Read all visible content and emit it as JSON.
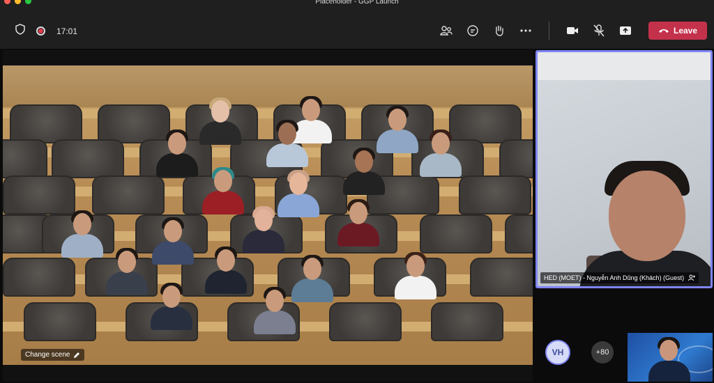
{
  "window": {
    "title": "Placeholder - GGP Launch"
  },
  "toolbar": {
    "timer": "17:01",
    "leave_label": "Leave",
    "icons": [
      "shield-icon",
      "recording-icon",
      "people-icon",
      "chat-icon",
      "raise-hand-icon",
      "more-icon",
      "camera-icon",
      "mic-off-icon",
      "share-icon",
      "phone-icon"
    ]
  },
  "stage": {
    "change_scene_label": "Change scene"
  },
  "spotlight": {
    "name": "HED (MOET) - Nguyễn Anh Dũng (Khách) (Guest)"
  },
  "gallery": {
    "avatar_initials": "VH",
    "overflow_count": "+80"
  },
  "colors": {
    "accent": "#7f85f5",
    "leave": "#c4314b",
    "toolbar_bg": "#1f1f1f"
  }
}
